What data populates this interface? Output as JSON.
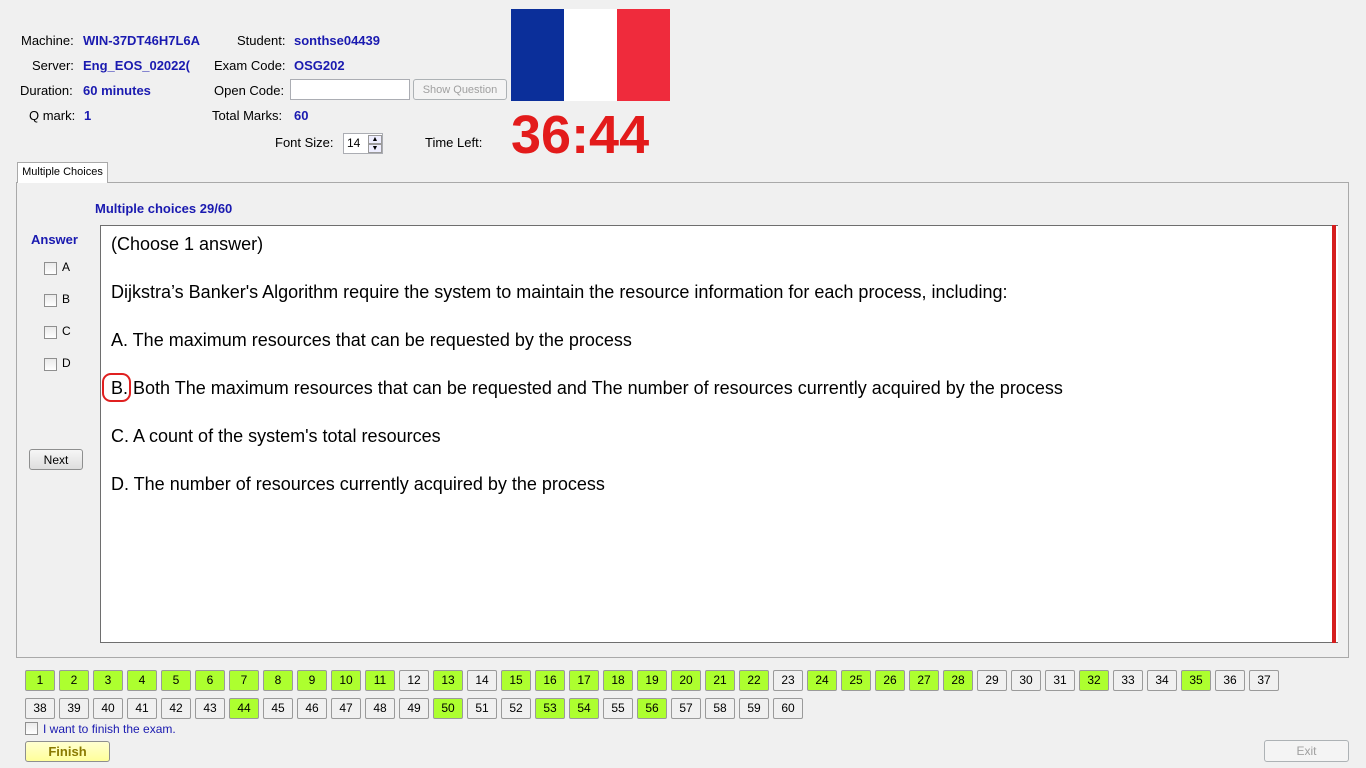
{
  "header": {
    "machine_label": "Machine:",
    "machine_value": "WIN-37DT46H7L6A",
    "student_label": "Student:",
    "student_value": "sonthse04439",
    "server_label": "Server:",
    "server_value": "Eng_EOS_02022(",
    "exam_code_label": "Exam Code:",
    "exam_code_value": "OSG202",
    "duration_label": "Duration:",
    "duration_value": "60 minutes",
    "open_code_label": "Open Code:",
    "open_code_value": "",
    "show_question_label": "Show Question",
    "qmark_label": "Q mark:",
    "qmark_value": "1",
    "total_marks_label": "Total Marks:",
    "total_marks_value": "60",
    "font_size_label": "Font Size:",
    "font_size_value": "14",
    "time_left_label": "Time Left:",
    "time_left_value": "36:44",
    "flag_colors": [
      "#0b2f9a",
      "#ffffff",
      "#ef2b3c"
    ]
  },
  "tabs": [
    {
      "label": "Multiple Choices"
    }
  ],
  "question": {
    "progress": "Multiple choices 29/60",
    "lines": [
      "(Choose 1 answer)",
      "Dijkstra’s Banker's Algorithm require the system to maintain the resource information for each process, including:",
      "A.  The maximum resources that can be requested by the process",
      "B.  Both The maximum resources that can be requested and The number of resources currently acquired by the process",
      "C.  A count of the system's total resources",
      "D.  The number of resources currently acquired by the process"
    ]
  },
  "answer": {
    "title": "Answer",
    "options": [
      "A",
      "B",
      "C",
      "D"
    ],
    "next_label": "Next"
  },
  "navigator": {
    "row1": [
      "1",
      "2",
      "3",
      "4",
      "5",
      "6",
      "7",
      "8",
      "9",
      "10",
      "11",
      "12",
      "13",
      "14",
      "15",
      "16",
      "17",
      "18",
      "19",
      "20",
      "21",
      "22",
      "23",
      "24",
      "25",
      "26",
      "27",
      "28",
      "29",
      "30",
      "31",
      "32",
      "33",
      "34",
      "35",
      "36",
      "37"
    ],
    "row2": [
      "38",
      "39",
      "40",
      "41",
      "42",
      "43",
      "44",
      "45",
      "46",
      "47",
      "48",
      "49",
      "50",
      "51",
      "52",
      "53",
      "54",
      "55",
      "56",
      "57",
      "58",
      "59",
      "60"
    ],
    "answered": [
      "1",
      "2",
      "3",
      "4",
      "5",
      "6",
      "7",
      "8",
      "9",
      "10",
      "11",
      "13",
      "15",
      "16",
      "17",
      "18",
      "19",
      "20",
      "21",
      "22",
      "24",
      "25",
      "26",
      "27",
      "28",
      "32",
      "35",
      "44",
      "50",
      "53",
      "54",
      "56"
    ],
    "answered_color": "#adff2f"
  },
  "footer": {
    "finish_checkbox_label": "I want to finish the exam.",
    "finish_label": "Finish",
    "exit_label": "Exit"
  }
}
